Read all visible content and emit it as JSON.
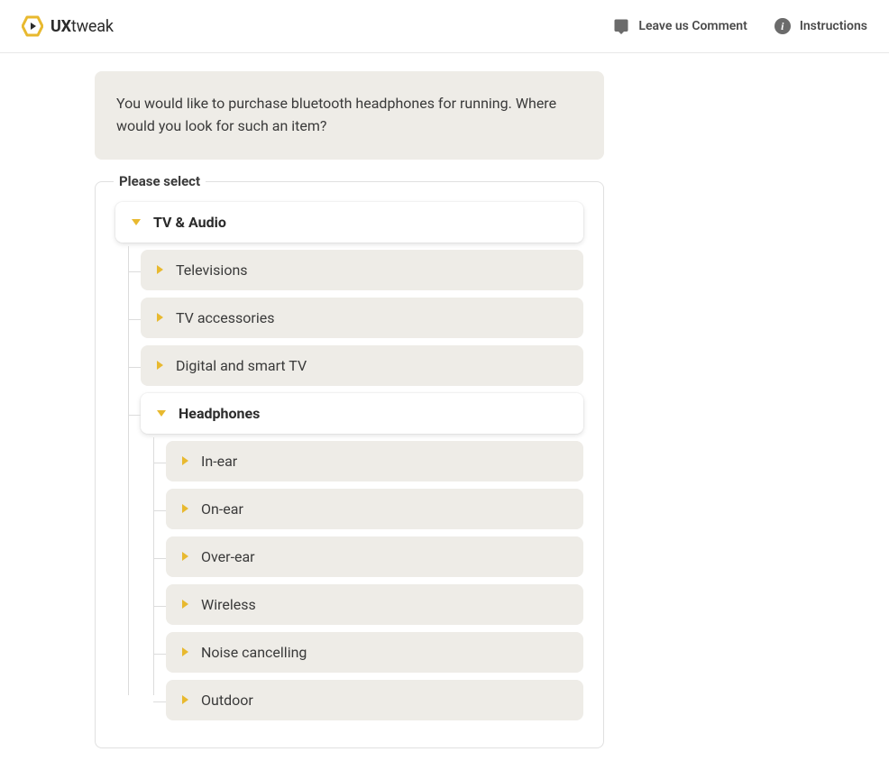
{
  "header": {
    "brand_bold": "UX",
    "brand_light": "tweak",
    "leave_comment": "Leave us Comment",
    "instructions": "Instructions"
  },
  "task": {
    "prompt": "You would like to purchase bluetooth headphones for running. Where would you look for such an item?"
  },
  "fieldset": {
    "label": "Please select"
  },
  "tree": {
    "root": {
      "label": "TV & Audio",
      "children": [
        {
          "label": "Televisions"
        },
        {
          "label": "TV accessories"
        },
        {
          "label": "Digital and smart TV"
        },
        {
          "label": "Headphones",
          "children": [
            {
              "label": "In-ear"
            },
            {
              "label": "On-ear"
            },
            {
              "label": "Over-ear"
            },
            {
              "label": "Wireless"
            },
            {
              "label": "Noise cancelling"
            },
            {
              "label": "Outdoor"
            }
          ]
        }
      ]
    }
  }
}
